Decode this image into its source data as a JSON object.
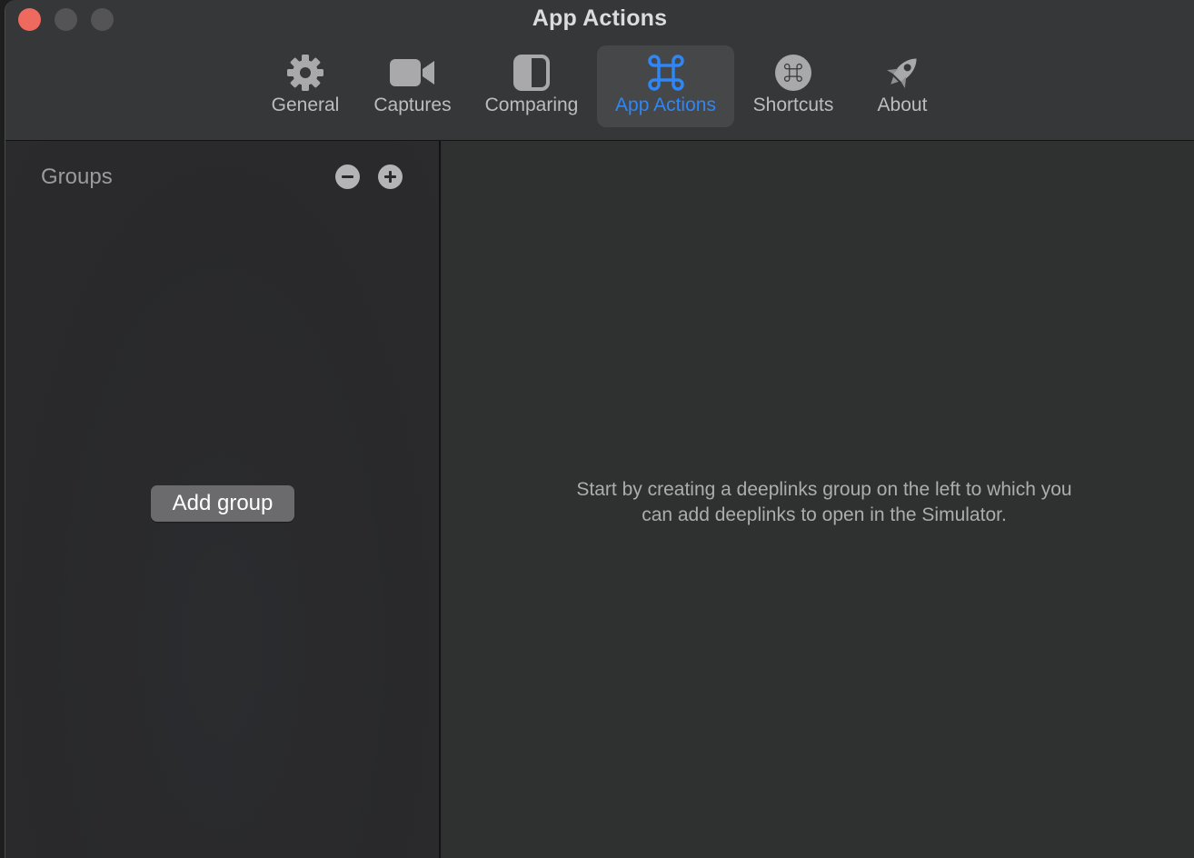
{
  "window": {
    "title": "App Actions"
  },
  "toolbar": {
    "tabs": [
      {
        "label": "General",
        "icon": "gear-icon",
        "active": false
      },
      {
        "label": "Captures",
        "icon": "video-camera-icon",
        "active": false
      },
      {
        "label": "Comparing",
        "icon": "split-view-icon",
        "active": false
      },
      {
        "label": "App Actions",
        "icon": "command-icon",
        "active": true
      },
      {
        "label": "Shortcuts",
        "icon": "command-circle-icon",
        "active": false
      },
      {
        "label": "About",
        "icon": "rocket-icon",
        "active": false
      }
    ]
  },
  "sidebar": {
    "title": "Groups",
    "add_group_label": "Add group"
  },
  "main": {
    "empty_message_line1": "Start by creating a deeplinks group on the left to which you",
    "empty_message_line2": "can add deeplinks to open in the Simulator."
  },
  "colors": {
    "accent": "#2f86f6",
    "close": "#ee6a5f"
  }
}
